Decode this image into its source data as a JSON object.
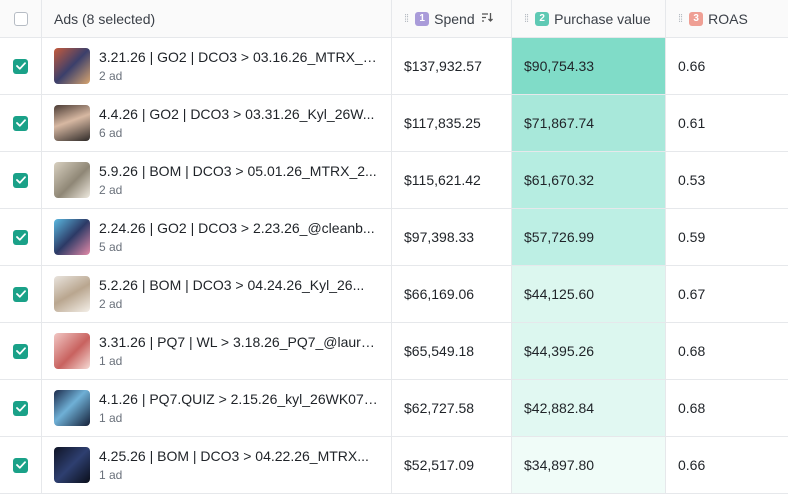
{
  "header": {
    "ads_label": "Ads (8 selected)",
    "spend": {
      "badge": "1",
      "label": "Spend",
      "badge_color": "#a99bd9",
      "sort_icon": "sort-descending-icon"
    },
    "purchase_value": {
      "badge": "2",
      "label": "Purchase value",
      "badge_color": "#5ec9b4"
    },
    "roas": {
      "badge": "3",
      "label": "ROAS",
      "badge_color": "#ef9f94"
    }
  },
  "colors": {
    "accent": "#1aa188",
    "heat_high": "#80dcc8",
    "heat_low": "#f0fcf8"
  },
  "rows": [
    {
      "name": "3.21.26 | GO2 | DCO3 > 03.16.26_MTRX_2...",
      "count": "2 ad",
      "spend": "$137,932.57",
      "purchase_value": "$90,754.33",
      "roas": "0.66",
      "thumb": "thumbnail-image",
      "heat": "#80dcc8"
    },
    {
      "name": "4.4.26 | GO2 | DCO3 > 03.31.26_Kyl_26W...",
      "count": "6 ad",
      "spend": "$117,835.25",
      "purchase_value": "$71,867.74",
      "roas": "0.61",
      "thumb": "thumbnail-image",
      "heat": "#a8e8da"
    },
    {
      "name": "5.9.26 | BOM | DCO3 > 05.01.26_MTRX_2...",
      "count": "2 ad",
      "spend": "$115,621.42",
      "purchase_value": "$61,670.32",
      "roas": "0.53",
      "thumb": "thumbnail-image",
      "heat": "#b6ede1"
    },
    {
      "name": "2.24.26 | GO2 | DCO3 > 2.23.26_@cleanb...",
      "count": "5 ad",
      "spend": "$97,398.33",
      "purchase_value": "$57,726.99",
      "roas": "0.59",
      "thumb": "thumbnail-image",
      "heat": "#bdefe4"
    },
    {
      "name": "5.2.26 | BOM | DCO3 > 04.24.26_Kyl_26...",
      "count": "2 ad",
      "spend": "$66,169.06",
      "purchase_value": "$44,125.60",
      "roas": "0.67",
      "thumb": "thumbnail-image",
      "heat": "#dcf7ef"
    },
    {
      "name": "3.31.26 | PQ7 | WL > 3.18.26_PQ7_@lauren...",
      "count": "1 ad",
      "spend": "$65,549.18",
      "purchase_value": "$44,395.26",
      "roas": "0.68",
      "thumb": "thumbnail-image",
      "heat": "#dcf7ef"
    },
    {
      "name": "4.1.26 | PQ7.QUIZ > 2.15.26_kyl_26WK07_...",
      "count": "1 ad",
      "spend": "$62,727.58",
      "purchase_value": "$42,882.84",
      "roas": "0.68",
      "thumb": "thumbnail-image",
      "heat": "#e1f8f2"
    },
    {
      "name": "4.25.26 | BOM | DCO3 > 04.22.26_MTRX...",
      "count": "1 ad",
      "spend": "$52,517.09",
      "purchase_value": "$34,897.80",
      "roas": "0.66",
      "thumb": "thumbnail-image",
      "heat": "#f0fcf8"
    }
  ]
}
